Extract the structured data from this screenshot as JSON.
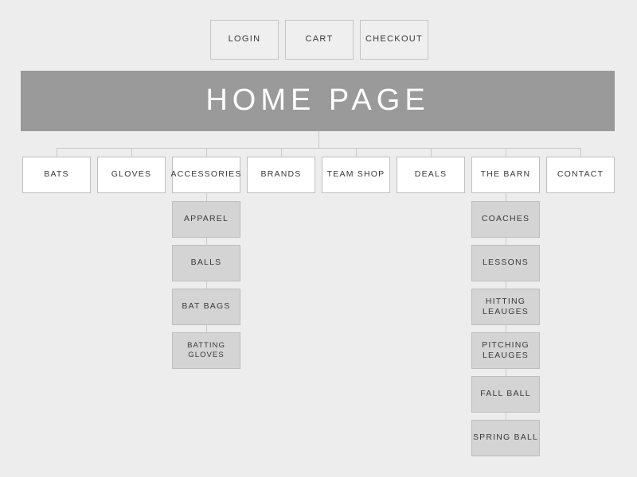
{
  "diagram": {
    "title": "HOME PAGE",
    "background_color": "#ededed",
    "hero_color": "#9a9a9a",
    "nav_box_color": "#ffffff",
    "sub_box_color": "#d4d4d4",
    "connector_color": "#c9c9c9"
  },
  "utility_row": [
    {
      "label": "LOGIN"
    },
    {
      "label": "CART"
    },
    {
      "label": "CHECKOUT"
    }
  ],
  "hero": {
    "label": "HOME PAGE"
  },
  "nav": [
    {
      "label": "BATS"
    },
    {
      "label": "GLOVES"
    },
    {
      "label": "ACCESSORIES"
    },
    {
      "label": "BRANDS"
    },
    {
      "label": "TEAM SHOP"
    },
    {
      "label": "DEALS"
    },
    {
      "label": "THE BARN"
    },
    {
      "label": "CONTACT"
    }
  ],
  "accessories_children": [
    {
      "label": "APPAREL"
    },
    {
      "label": "BALLS"
    },
    {
      "label": "BAT BAGS"
    },
    {
      "label": "BATTING GLOVES"
    }
  ],
  "barn_children": [
    {
      "line1": "COACHES",
      "line2": ""
    },
    {
      "line1": "LESSONS",
      "line2": ""
    },
    {
      "line1": "HITTING",
      "line2": "LEAUGES"
    },
    {
      "line1": "PITCHING",
      "line2": "LEAUGES"
    },
    {
      "line1": "FALL BALL",
      "line2": ""
    },
    {
      "line1": "SPRING BALL",
      "line2": ""
    }
  ]
}
